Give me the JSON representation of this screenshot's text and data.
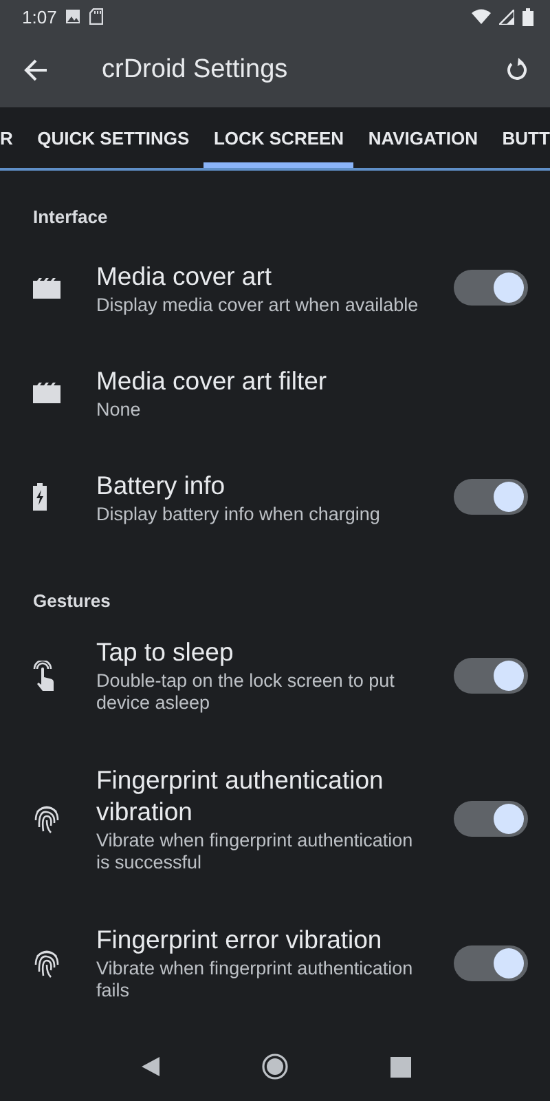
{
  "status_bar": {
    "time": "1:07"
  },
  "app_bar": {
    "title": "crDroid Settings"
  },
  "tabs": [
    {
      "label": "R",
      "selected": false
    },
    {
      "label": "QUICK SETTINGS",
      "selected": false
    },
    {
      "label": "LOCK SCREEN",
      "selected": true
    },
    {
      "label": "NAVIGATION",
      "selected": false
    },
    {
      "label": "BUTT",
      "selected": false
    }
  ],
  "categories": [
    {
      "title": "Interface",
      "items": [
        {
          "kind": "switch",
          "title": "Media cover art",
          "summary": "Display media cover art when available",
          "on": true
        },
        {
          "kind": "list",
          "title": "Media cover art filter",
          "summary": "None"
        },
        {
          "kind": "switch",
          "title": "Battery info",
          "summary": "Display battery info when charging",
          "on": true
        }
      ]
    },
    {
      "title": "Gestures",
      "items": [
        {
          "kind": "switch",
          "title": "Tap to sleep",
          "summary": "Double-tap on the lock screen to put device asleep",
          "on": true
        },
        {
          "kind": "switch",
          "title": "Fingerprint authentication vibration",
          "summary": "Vibrate when fingerprint authentication is successful",
          "on": true
        },
        {
          "kind": "switch",
          "title": "Fingerprint error vibration",
          "summary": "Vibrate when fingerprint authentication fails",
          "on": true
        }
      ]
    }
  ]
}
